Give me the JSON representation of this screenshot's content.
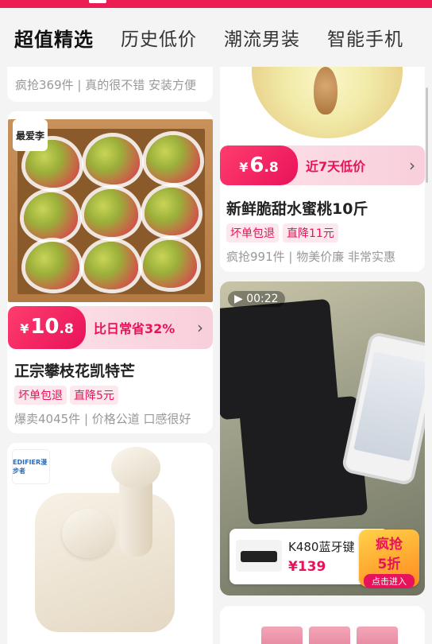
{
  "tabs": [
    {
      "label": "超值精选",
      "active": true
    },
    {
      "label": "历史低价",
      "active": false
    },
    {
      "label": "潮流男装",
      "active": false
    },
    {
      "label": "智能手机",
      "active": false
    }
  ],
  "left_top_card": {
    "meta": "疯抢369件 | 真的很不错 安装方便"
  },
  "mango_card": {
    "shop_badge": "最爱李",
    "price_int": "10",
    "price_dec": ".8",
    "yen": "¥",
    "promo": "比日常省32%",
    "title": "正宗攀枝花凯特芒",
    "tags": [
      "坏单包退",
      "直降5元"
    ],
    "meta": "爆卖4045件 | 价格公道 口感很好"
  },
  "earbuds_card": {
    "brand_logo": "EDIFIER漫步者"
  },
  "peach_card": {
    "price_int": "6",
    "price_dec": ".8",
    "yen": "¥",
    "promo": "近7天低价",
    "title": "新鲜脆甜水蜜桃10斤",
    "tags": [
      "坏单包退",
      "直降11元"
    ],
    "meta": "疯抢991件 | 物美价廉 非常实惠"
  },
  "keyboard_card": {
    "video_time": "00:22",
    "mini_title": "K480蓝牙键",
    "mini_price": "¥139",
    "promo_badge": {
      "line1": "疯抢",
      "line2": "5折",
      "cta": "点击进入"
    }
  },
  "colors": {
    "accent": "#e8125a",
    "topbar": "#ec1c55"
  }
}
